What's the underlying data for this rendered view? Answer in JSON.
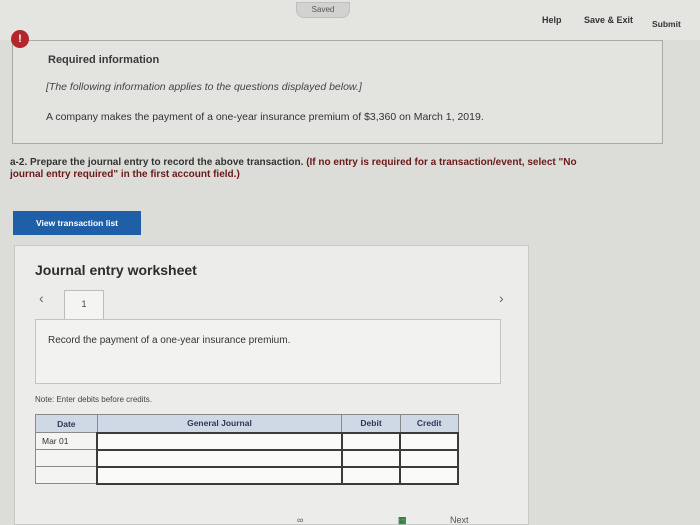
{
  "topbar": {
    "saved_label": "Saved",
    "help_label": "Help",
    "save_exit_label": "Save & Exit",
    "submit_label": "Submit"
  },
  "alert": {
    "symbol": "!"
  },
  "info": {
    "title": "Required information",
    "note": "[The following information applies to the questions displayed below.]",
    "text": "A company makes the payment of a one-year insurance premium of $3,360 on March 1, 2019."
  },
  "question": {
    "part1": "a-2. Prepare the journal entry to record the above transaction.",
    "part2": "(If no entry is required for a transaction/event, select \"No",
    "part3": "journal entry required\" in the first account field.)"
  },
  "view_transaction_label": "View transaction list",
  "worksheet": {
    "title": "Journal entry worksheet",
    "prev_icon": "‹",
    "next_icon": "›",
    "tab_number": "1",
    "record_text": "Record the payment of a one-year insurance premium.",
    "note": "Note: Enter debits before credits."
  },
  "journal": {
    "headers": {
      "date": "Date",
      "general_journal": "General Journal",
      "debit": "Debit",
      "credit": "Credit"
    },
    "rows": [
      {
        "date": "Mar 01",
        "account": "",
        "debit": "",
        "credit": ""
      },
      {
        "date": "",
        "account": "",
        "debit": "",
        "credit": ""
      },
      {
        "date": "",
        "account": "",
        "debit": "",
        "credit": ""
      }
    ]
  },
  "bottom": {
    "link_icon": "link-icon",
    "grid_icon": "grid-icon",
    "next_label": "Next"
  }
}
